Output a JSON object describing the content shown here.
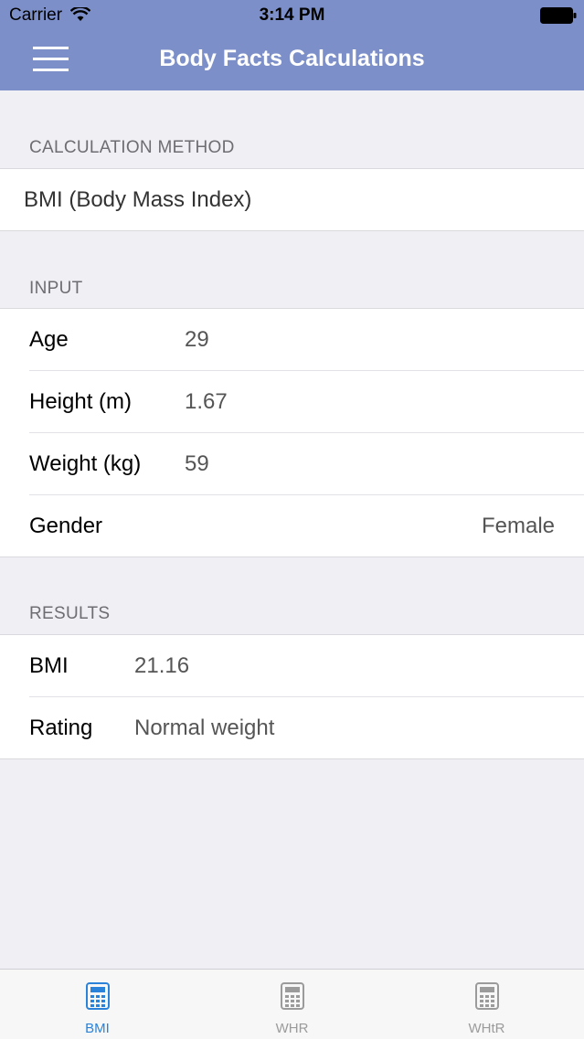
{
  "status": {
    "carrier": "Carrier",
    "time": "3:14 PM"
  },
  "nav": {
    "title": "Body Facts Calculations",
    "menu_icon": "hamburger-icon"
  },
  "sections": {
    "method_header": "CALCULATION METHOD",
    "method_value": "BMI (Body Mass Index)",
    "input_header": "INPUT",
    "results_header": "RESULTS"
  },
  "inputs": [
    {
      "label": "Age",
      "value": "29"
    },
    {
      "label": "Height (m)",
      "value": "1.67"
    },
    {
      "label": "Weight (kg)",
      "value": "59"
    },
    {
      "label": "Gender",
      "value": "Female"
    }
  ],
  "results": [
    {
      "label": "BMI",
      "value": "21.16"
    },
    {
      "label": "Rating",
      "value": "Normal weight"
    }
  ],
  "tabs": [
    {
      "label": "BMI",
      "icon": "calculator-icon",
      "active": true
    },
    {
      "label": "WHR",
      "icon": "calculator-icon",
      "active": false
    },
    {
      "label": "WHtR",
      "icon": "calculator-icon",
      "active": false
    }
  ],
  "colors": {
    "header": "#7c8fc9",
    "tab_active": "#2a83d8",
    "tab_inactive": "#9b9b9b"
  }
}
